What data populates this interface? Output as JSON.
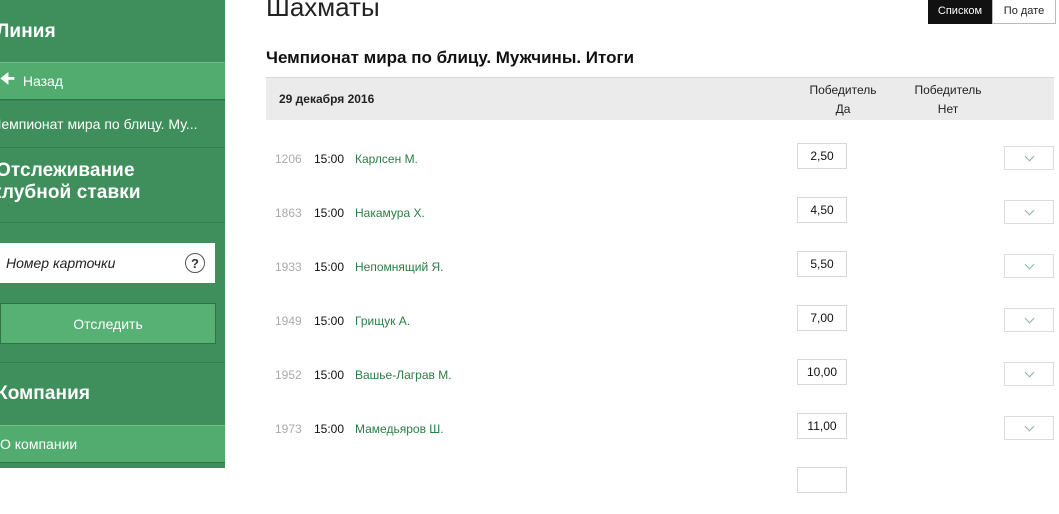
{
  "sidebar": {
    "line_heading": "Линия",
    "back_label": "Назад",
    "current_item": "Чемпионат мира по блицу. Му...",
    "tracking_heading_1": "Отслеживание",
    "tracking_heading_2": "клубной ставки",
    "card_placeholder": "Номер карточки",
    "help_glyph": "?",
    "track_button": "Отследить",
    "company_heading": "Компания",
    "about_company": "О компании"
  },
  "main": {
    "title": "Шахматы",
    "view_list": "Списком",
    "view_date": "По дате",
    "subtitle": "Чемпионат мира по блицу. Мужчины. Итоги",
    "table": {
      "date": "29 декабря 2016",
      "col_yes_1": "Победитель",
      "col_yes_2": "Да",
      "col_no_1": "Победитель",
      "col_no_2": "Нет",
      "rows": [
        {
          "id": "1206",
          "time": "15:00",
          "name": "Карлсен М.",
          "odd": "2,50"
        },
        {
          "id": "1863",
          "time": "15:00",
          "name": "Накамура Х.",
          "odd": "4,50"
        },
        {
          "id": "1933",
          "time": "15:00",
          "name": "Непомнящий Я.",
          "odd": "5,50"
        },
        {
          "id": "1949",
          "time": "15:00",
          "name": "Грищук А.",
          "odd": "7,00"
        },
        {
          "id": "1952",
          "time": "15:00",
          "name": "Вашье-Лаграв М.",
          "odd": "10,00"
        },
        {
          "id": "1973",
          "time": "15:00",
          "name": "Мамедьяров Ш.",
          "odd": "11,00"
        }
      ]
    }
  },
  "colors": {
    "sidebar_bg": "#3f8f5c",
    "sidebar_row": "#52ab6f",
    "link_green": "#2a7d45"
  }
}
